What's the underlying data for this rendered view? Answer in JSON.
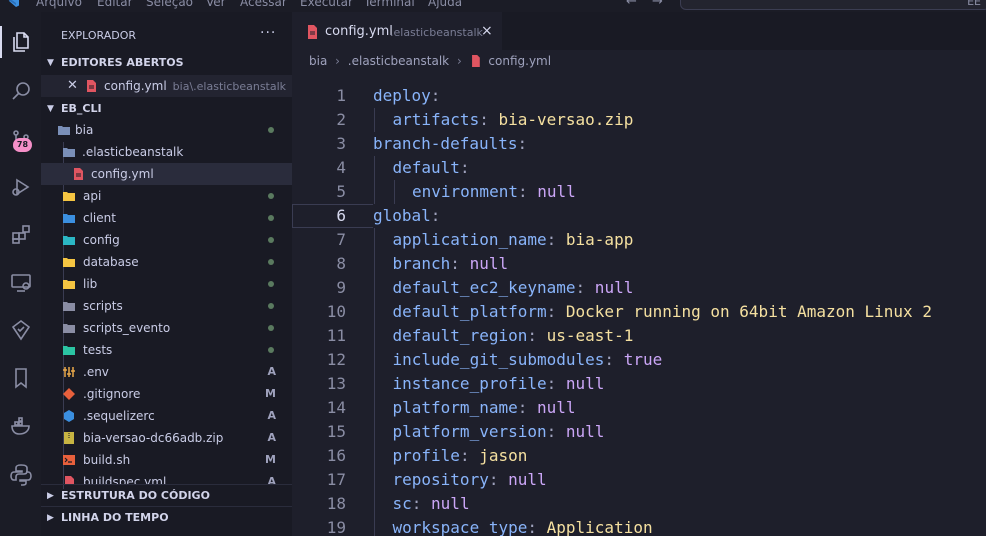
{
  "menubar": {
    "items": [
      "Arquivo",
      "Editar",
      "Seleção",
      "Ver",
      "Acessar",
      "Executar",
      "Terminal",
      "Ajuda"
    ],
    "search_text": "EE"
  },
  "activity": {
    "source_control_badge": "78"
  },
  "sidebar": {
    "title": "EXPLORADOR",
    "more": "···",
    "open_editors": {
      "header": "EDITORES ABERTOS",
      "items": [
        {
          "name": "config.yml",
          "path": "bia\\.elasticbeanstalk"
        }
      ]
    },
    "workspace": {
      "header": "EB_CLI",
      "items": [
        {
          "name": "bia",
          "status": "dot"
        },
        {
          "name": ".elasticbeanstalk",
          "status": ""
        },
        {
          "name": "config.yml",
          "status": ""
        },
        {
          "name": "api",
          "status": "dot"
        },
        {
          "name": "client",
          "status": "dot"
        },
        {
          "name": "config",
          "status": "dot"
        },
        {
          "name": "database",
          "status": "dot"
        },
        {
          "name": "lib",
          "status": "dot"
        },
        {
          "name": "scripts",
          "status": "dot"
        },
        {
          "name": "scripts_evento",
          "status": "dot"
        },
        {
          "name": "tests",
          "status": "dot"
        },
        {
          "name": ".env",
          "status": "A"
        },
        {
          "name": ".gitignore",
          "status": "M"
        },
        {
          "name": ".sequelizerc",
          "status": "A"
        },
        {
          "name": "bia-versao-dc66adb.zip",
          "status": "A"
        },
        {
          "name": "build.sh",
          "status": "M"
        },
        {
          "name": "buildspec.yml",
          "status": "A"
        }
      ]
    },
    "outline": {
      "header": "ESTRUTURA DO CÓDIGO"
    },
    "timeline": {
      "header": "LINHA DO TEMPO"
    }
  },
  "editor": {
    "tab": {
      "name": "config.yml",
      "path": ".elasticbeanstalk",
      "close": "×"
    },
    "breadcrumb": [
      "bia",
      ".elasticbeanstalk",
      "config.yml"
    ],
    "current_line": 6,
    "lines": [
      {
        "n": "1",
        "indent": 0,
        "key": "deploy",
        "value": "",
        "vtype": ""
      },
      {
        "n": "2",
        "indent": 1,
        "key": "artifacts",
        "value": "bia-versao.zip",
        "vtype": "str"
      },
      {
        "n": "3",
        "indent": 0,
        "key": "branch-defaults",
        "value": "",
        "vtype": ""
      },
      {
        "n": "4",
        "indent": 1,
        "key": "default",
        "value": "",
        "vtype": ""
      },
      {
        "n": "5",
        "indent": 2,
        "key": "environment",
        "value": "null",
        "vtype": "kw"
      },
      {
        "n": "6",
        "indent": 0,
        "key": "global",
        "value": "",
        "vtype": ""
      },
      {
        "n": "7",
        "indent": 1,
        "key": "application_name",
        "value": "bia-app",
        "vtype": "str"
      },
      {
        "n": "8",
        "indent": 1,
        "key": "branch",
        "value": "null",
        "vtype": "kw"
      },
      {
        "n": "9",
        "indent": 1,
        "key": "default_ec2_keyname",
        "value": "null",
        "vtype": "kw"
      },
      {
        "n": "10",
        "indent": 1,
        "key": "default_platform",
        "value": "Docker running on 64bit Amazon Linux 2",
        "vtype": "str"
      },
      {
        "n": "11",
        "indent": 1,
        "key": "default_region",
        "value": "us-east-1",
        "vtype": "str"
      },
      {
        "n": "12",
        "indent": 1,
        "key": "include_git_submodules",
        "value": "true",
        "vtype": "kw"
      },
      {
        "n": "13",
        "indent": 1,
        "key": "instance_profile",
        "value": "null",
        "vtype": "kw"
      },
      {
        "n": "14",
        "indent": 1,
        "key": "platform_name",
        "value": "null",
        "vtype": "kw"
      },
      {
        "n": "15",
        "indent": 1,
        "key": "platform_version",
        "value": "null",
        "vtype": "kw"
      },
      {
        "n": "16",
        "indent": 1,
        "key": "profile",
        "value": "jason",
        "vtype": "str"
      },
      {
        "n": "17",
        "indent": 1,
        "key": "repository",
        "value": "null",
        "vtype": "kw"
      },
      {
        "n": "18",
        "indent": 1,
        "key": "sc",
        "value": "null",
        "vtype": "kw"
      },
      {
        "n": "19",
        "indent": 1,
        "key": "workspace_type",
        "value": "Application",
        "vtype": "str"
      }
    ]
  }
}
